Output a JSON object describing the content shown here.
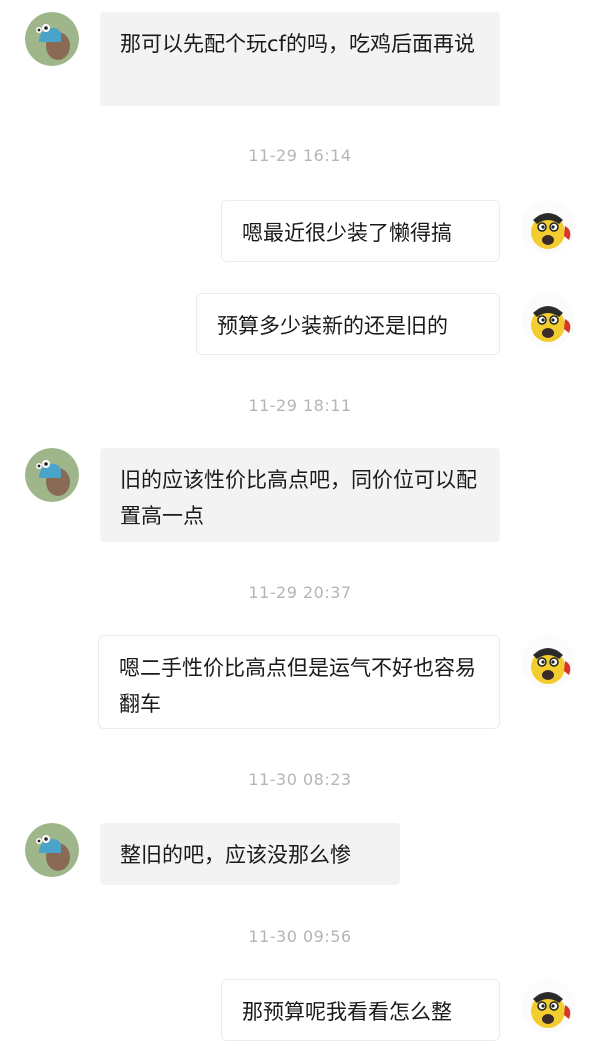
{
  "messages": [
    {
      "side": "in",
      "text": "那可以先配个玩cf的吗，吃鸡后面再说"
    },
    {
      "time": "11-29 16:14"
    },
    {
      "side": "out",
      "text": "嗯最近很少装了懒得搞"
    },
    {
      "side": "out",
      "text": "预算多少装新的还是旧的"
    },
    {
      "time": "11-29 18:11"
    },
    {
      "side": "in",
      "text": "旧的应该性价比高点吧，同价位可以配置高一点"
    },
    {
      "time": "11-29 20:37"
    },
    {
      "side": "out",
      "text": "嗯二手性价比高点但是运气不好也容易翻车"
    },
    {
      "time": "11-30 08:23"
    },
    {
      "side": "in",
      "text": "整旧的吧，应该没那么惨"
    },
    {
      "time": "11-30 09:56"
    },
    {
      "side": "out",
      "text": "那预算呢我看看怎么整"
    }
  ],
  "avatars": {
    "incoming": "snail-avatar-icon",
    "outgoing": "cartoon-face-avatar-icon"
  },
  "colors": {
    "incoming_bubble": "#f3f3f3",
    "outgoing_bubble": "#ffffff",
    "timestamp": "#b5b5b5"
  }
}
